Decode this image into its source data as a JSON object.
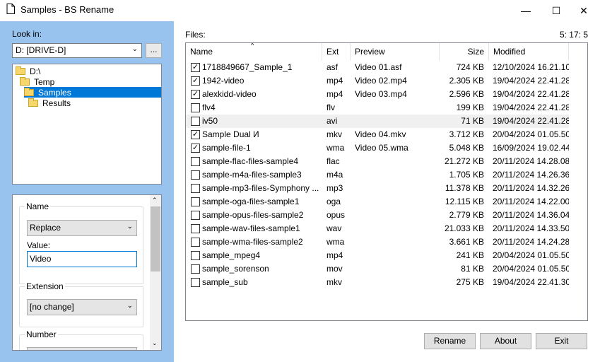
{
  "window": {
    "title": "Samples - BS Rename",
    "minimize": "—",
    "maximize": "☐",
    "close": "✕"
  },
  "left": {
    "look_in_label": "Look in:",
    "drive_value": "D: [DRIVE-D]",
    "browse_label": "...",
    "tree": [
      {
        "label": "D:\\",
        "depth": 0,
        "selected": false
      },
      {
        "label": "Temp",
        "depth": 1,
        "selected": false
      },
      {
        "label": "Samples",
        "depth": 2,
        "selected": true
      },
      {
        "label": "Results",
        "depth": 3,
        "selected": false
      }
    ],
    "name_group": {
      "legend": "Name",
      "mode": "Replace",
      "value_label": "Value:",
      "value": "Video"
    },
    "extension_group": {
      "legend": "Extension",
      "mode": "[no change]"
    },
    "number_group": {
      "legend": "Number"
    }
  },
  "files": {
    "label": "Files:",
    "counts": "5: 17: 5",
    "columns": {
      "name": "Name",
      "ext": "Ext",
      "preview": "Preview",
      "size": "Size",
      "modified": "Modified"
    },
    "rows": [
      {
        "checked": true,
        "name": "1718849667_Sample_1",
        "ext": "asf",
        "preview": "Video 01.asf",
        "size": "724 KB",
        "modified": "12/10/2024 16.21.10",
        "selected": false
      },
      {
        "checked": true,
        "name": "1942-video",
        "ext": "mp4",
        "preview": "Video 02.mp4",
        "size": "2.305 KB",
        "modified": "19/04/2024 22.41.28",
        "selected": false
      },
      {
        "checked": true,
        "name": "alexkidd-video",
        "ext": "mp4",
        "preview": "Video 03.mp4",
        "size": "2.596 KB",
        "modified": "19/04/2024 22.41.28",
        "selected": false
      },
      {
        "checked": false,
        "name": "flv4",
        "ext": "flv",
        "preview": "",
        "size": "199 KB",
        "modified": "19/04/2024 22.41.28",
        "selected": false
      },
      {
        "checked": false,
        "name": "iv50",
        "ext": "avi",
        "preview": "",
        "size": "71 KB",
        "modified": "19/04/2024 22.41.28",
        "selected": true
      },
      {
        "checked": true,
        "name": "Sample Dual И",
        "ext": "mkv",
        "preview": "Video 04.mkv",
        "size": "3.712 KB",
        "modified": "20/04/2024 01.05.50",
        "selected": false
      },
      {
        "checked": true,
        "name": "sample-file-1",
        "ext": "wma",
        "preview": "Video 05.wma",
        "size": "5.048 KB",
        "modified": "16/09/2024 19.02.44",
        "selected": false
      },
      {
        "checked": false,
        "name": "sample-flac-files-sample4",
        "ext": "flac",
        "preview": "",
        "size": "21.272 KB",
        "modified": "20/11/2024 14.28.08",
        "selected": false
      },
      {
        "checked": false,
        "name": "sample-m4a-files-sample3",
        "ext": "m4a",
        "preview": "",
        "size": "1.705 KB",
        "modified": "20/11/2024 14.26.36",
        "selected": false
      },
      {
        "checked": false,
        "name": "sample-mp3-files-Symphony ...",
        "ext": "mp3",
        "preview": "",
        "size": "11.378 KB",
        "modified": "20/11/2024 14.32.26",
        "selected": false
      },
      {
        "checked": false,
        "name": "sample-oga-files-sample1",
        "ext": "oga",
        "preview": "",
        "size": "12.115 KB",
        "modified": "20/11/2024 14.22.00",
        "selected": false
      },
      {
        "checked": false,
        "name": "sample-opus-files-sample2",
        "ext": "opus",
        "preview": "",
        "size": "2.779 KB",
        "modified": "20/11/2024 14.36.04",
        "selected": false
      },
      {
        "checked": false,
        "name": "sample-wav-files-sample1",
        "ext": "wav",
        "preview": "",
        "size": "21.033 KB",
        "modified": "20/11/2024 14.33.50",
        "selected": false
      },
      {
        "checked": false,
        "name": "sample-wma-files-sample2",
        "ext": "wma",
        "preview": "",
        "size": "3.661 KB",
        "modified": "20/11/2024 14.24.28",
        "selected": false
      },
      {
        "checked": false,
        "name": "sample_mpeg4",
        "ext": "mp4",
        "preview": "",
        "size": "241 KB",
        "modified": "20/04/2024 01.05.50",
        "selected": false
      },
      {
        "checked": false,
        "name": "sample_sorenson",
        "ext": "mov",
        "preview": "",
        "size": "81 KB",
        "modified": "20/04/2024 01.05.50",
        "selected": false
      },
      {
        "checked": false,
        "name": "sample_sub",
        "ext": "mkv",
        "preview": "",
        "size": "275 KB",
        "modified": "19/04/2024 22.41.30",
        "selected": false
      }
    ]
  },
  "buttons": {
    "rename": "Rename",
    "about": "About",
    "exit": "Exit"
  }
}
